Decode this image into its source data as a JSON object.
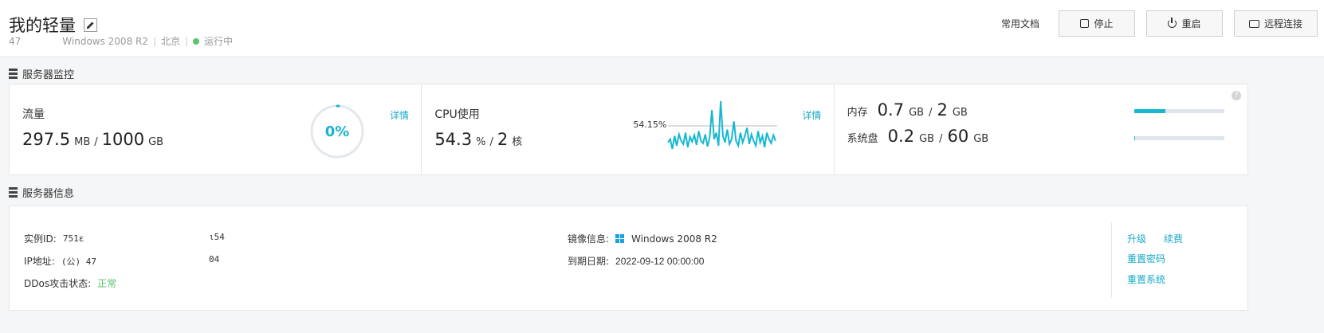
{
  "header": {
    "title": "我的轻量",
    "ip_prefix": "47",
    "os": "Windows 2008 R2",
    "region": "北京",
    "status": "运行中",
    "status_color": "#5cc26b",
    "doc_link": "常用文档",
    "buttons": {
      "stop": "停止",
      "restart": "重启",
      "remote": "远程连接"
    }
  },
  "monitor": {
    "section_title": "服务器监控",
    "traffic": {
      "label": "流量",
      "used": "297.5",
      "used_unit": "MB",
      "total": "1000",
      "total_unit": "GB",
      "percent_text": "0%",
      "percent": 0.01,
      "detail": "详情"
    },
    "cpu": {
      "label": "CPU使用",
      "value": "54.3",
      "unit": "%",
      "cores": "2",
      "cores_unit": "核",
      "avg_label": "54.15%",
      "detail": "详情",
      "samples": [
        48,
        52,
        40,
        56,
        44,
        58,
        50,
        46,
        60,
        42,
        55,
        49,
        57,
        45,
        62,
        50,
        47,
        58,
        43,
        54,
        88,
        52,
        60,
        44,
        99,
        56,
        48,
        64,
        46,
        52,
        74,
        50,
        44,
        60,
        48,
        56,
        66,
        46,
        58,
        50,
        44,
        62,
        48,
        56,
        42,
        60,
        52,
        47,
        57,
        50
      ]
    },
    "resources": {
      "memory_label": "内存",
      "memory_used": "0.7",
      "memory_unit": "GB",
      "memory_total": "2",
      "memory_total_unit": "GB",
      "memory_fraction": 0.35,
      "disk_label": "系统盘",
      "disk_used": "0.2",
      "disk_unit": "GB",
      "disk_total": "60",
      "disk_total_unit": "GB",
      "disk_fraction": 0.003,
      "help": "?"
    }
  },
  "info": {
    "section_title": "服务器信息",
    "instance_id_label": "实例ID:",
    "instance_id_head": "751ε",
    "instance_id_tail": "ι54",
    "ip_label": "IP地址:",
    "ip_prefix": "(公) 47",
    "ip_tail": "04",
    "ddos_label": "DDos攻击状态:",
    "ddos_status": "正常",
    "image_label": "镜像信息:",
    "image_value": "Windows 2008 R2",
    "expire_label": "到期日期:",
    "expire_value": "2022-09-12 00:00:00",
    "actions": {
      "upgrade": "升级",
      "renew": "续费",
      "reset_password": "重置密码",
      "reset_system": "重置系统"
    }
  }
}
